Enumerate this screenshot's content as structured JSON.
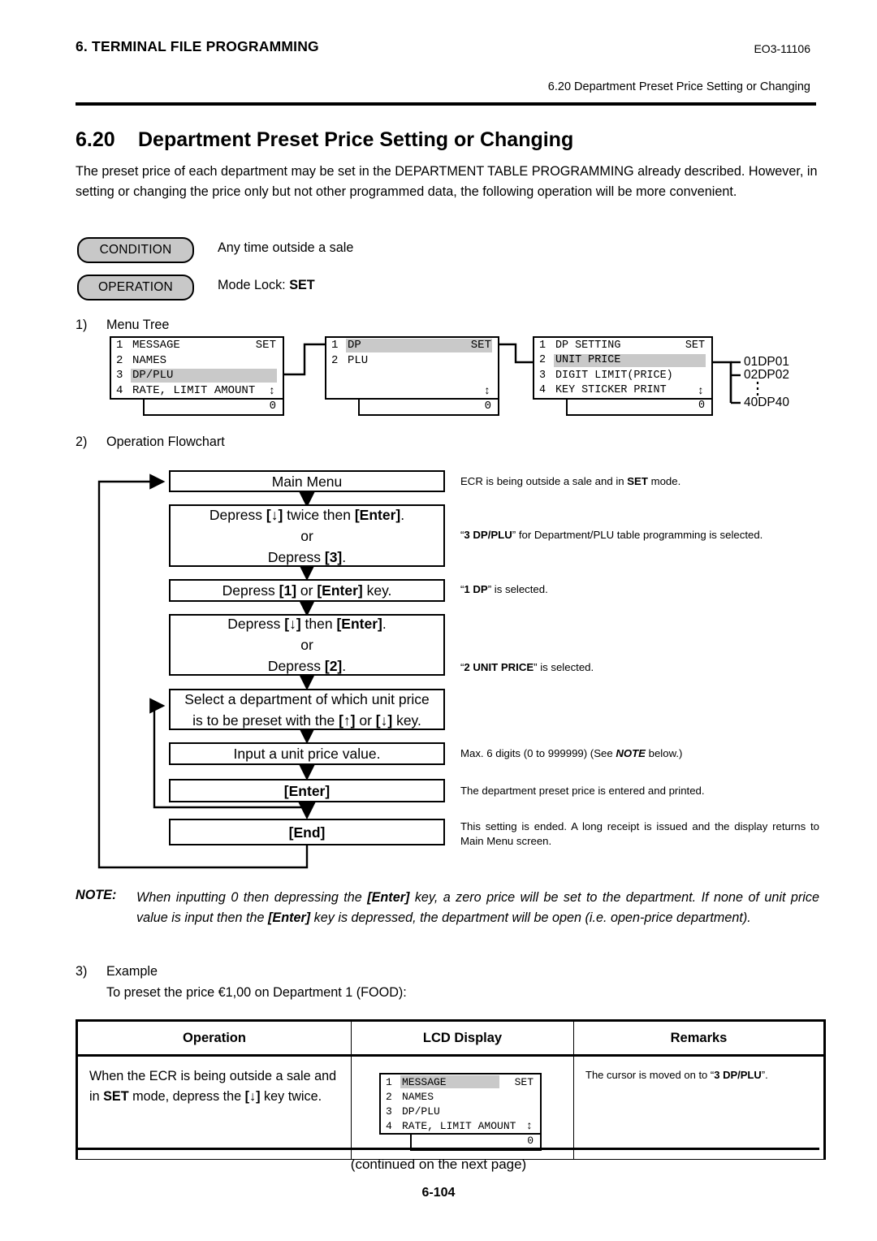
{
  "header": {
    "left_title": "6. TERMINAL FILE PROGRAMMING",
    "doc_code": "EO3-11106",
    "running_head": "6.20 Department Preset Price Setting or Changing"
  },
  "section": {
    "number": "6.20",
    "title": "Department Preset Price Setting or Changing",
    "intro": "The preset price of each department may be set in the DEPARTMENT TABLE PROGRAMMING already described.  However, in setting or changing the price only but not other programmed data, the following operation will be more convenient."
  },
  "condition": {
    "pill_label": "CONDITION",
    "value": "Any time outside a sale"
  },
  "operation": {
    "pill_label": "OPERATION",
    "value_prefix": "Mode Lock: ",
    "value_bold": "SET"
  },
  "steps": {
    "item1_num": "1)",
    "item1_label": "Menu Tree",
    "item2_num": "2)",
    "item2_label": "Operation Flowchart",
    "item3_num": "3)",
    "item3_label": "Example",
    "item3_detail": "To preset the price €1,00 on Department 1 (FOOD):"
  },
  "menu_tree": {
    "screen1": {
      "rows": [
        {
          "idx": "1",
          "label": "MESSAGE",
          "right": "SET",
          "highlight": false
        },
        {
          "idx": "2",
          "label": "NAMES",
          "right": "",
          "highlight": false
        },
        {
          "idx": "3",
          "label": "DP/PLU",
          "right": "",
          "highlight": true
        },
        {
          "idx": "4",
          "label": "RATE, LIMIT AMOUNT",
          "right": "",
          "highlight": false
        }
      ],
      "scroll_arrow": "↕",
      "status": "0"
    },
    "screen2": {
      "rows": [
        {
          "idx": "1",
          "label": "DP",
          "right": "SET",
          "highlight": true
        },
        {
          "idx": "2",
          "label": "PLU",
          "right": "",
          "highlight": false
        }
      ],
      "scroll_arrow": "↕",
      "status": "0"
    },
    "screen3": {
      "rows": [
        {
          "idx": "1",
          "label": "DP SETTING",
          "right": "SET",
          "highlight": false
        },
        {
          "idx": "2",
          "label": "UNIT PRICE",
          "right": "",
          "highlight": true
        },
        {
          "idx": "3",
          "label": "DIGIT LIMIT(PRICE)",
          "right": "",
          "highlight": false
        },
        {
          "idx": "4",
          "label": "KEY STICKER PRINT",
          "right": "",
          "highlight": false
        }
      ],
      "scroll_arrow": "↕",
      "status": "0"
    },
    "departments": [
      "01DP01",
      "02DP02",
      "40DP40"
    ]
  },
  "flowchart": {
    "boxes": [
      {
        "lines": [
          "Main Menu"
        ]
      },
      {
        "lines": [
          "Depress [↓] twice then [Enter].",
          "or",
          "Depress [3]."
        ]
      },
      {
        "lines": [
          "Depress [1] or [Enter] key."
        ]
      },
      {
        "lines": [
          "Depress [↓] then [Enter].",
          "or",
          "Depress [2]."
        ]
      },
      {
        "lines": [
          "Select a department of which unit price",
          "is to be preset with the [↑] or [↓] key."
        ]
      },
      {
        "lines": [
          "Input a unit price value."
        ]
      },
      {
        "lines": [
          "[Enter]"
        ]
      },
      {
        "lines": [
          "[End]"
        ]
      }
    ],
    "notes": [
      "ECR is being outside a sale and in SET mode.",
      "“3 DP/PLU” for Department/PLU table programming is selected.",
      "“1 DP” is selected.",
      "“2 UNIT PRICE” is selected.",
      "Max. 6 digits (0 to 999999) (See NOTE below.)",
      "The department preset price is entered and printed.",
      "This setting is ended.  A long receipt is issued and the display returns to Main Menu screen."
    ]
  },
  "note_block": {
    "label": "NOTE:",
    "text": "When inputting 0 then depressing the [Enter] key, a zero price will be set to the department.  If none of unit price value is input then the [Enter] key is depressed, the department will be open (i.e. open-price department)."
  },
  "example_table": {
    "headers": [
      "Operation",
      "LCD Display",
      "Remarks"
    ],
    "rows": [
      {
        "operation": "When the ECR is being outside a sale and in SET mode, depress the [↓] key twice.",
        "remarks": "The cursor is moved on to “3 DP/PLU”.",
        "lcd": {
          "rows": [
            {
              "idx": "1",
              "label": "MESSAGE",
              "right": "SET",
              "highlight": true
            },
            {
              "idx": "2",
              "label": "NAMES",
              "right": "",
              "highlight": false
            },
            {
              "idx": "3",
              "label": "DP/PLU",
              "right": "",
              "highlight": false
            },
            {
              "idx": "4",
              "label": "RATE, LIMIT AMOUNT",
              "right": "",
              "highlight": false
            }
          ],
          "scroll_arrow": "↕",
          "status": "0"
        }
      }
    ]
  },
  "footer": {
    "continued": "(continued on the next page)",
    "page_number": "6-104"
  }
}
